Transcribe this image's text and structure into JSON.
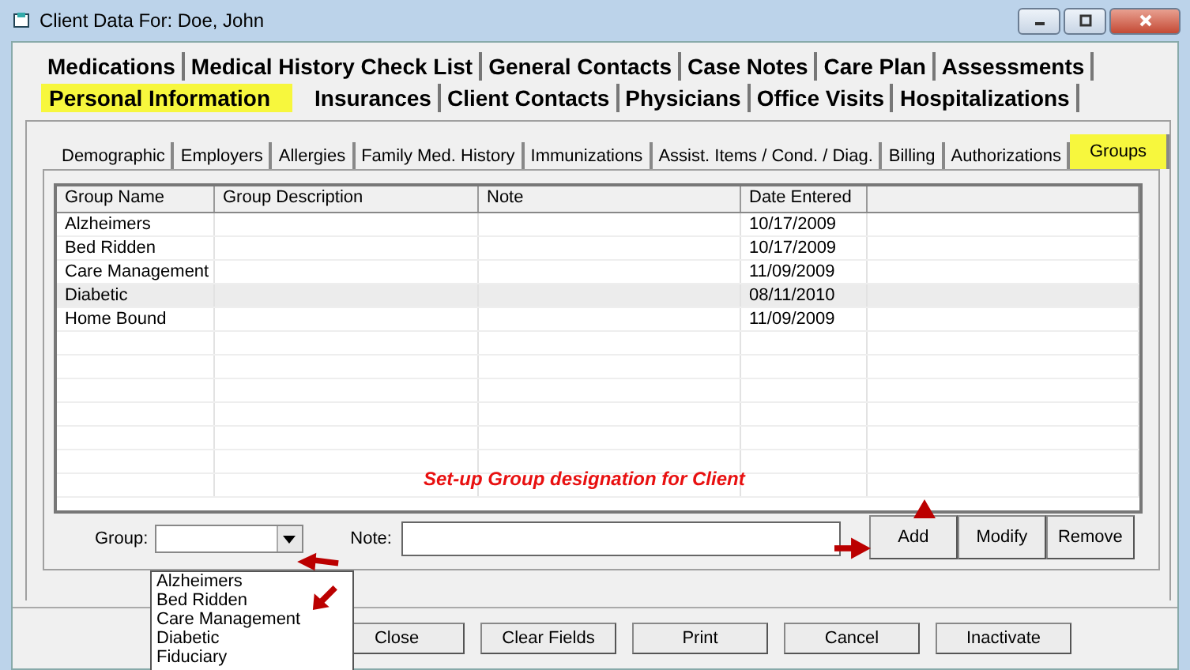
{
  "window": {
    "title": "Client Data For: Doe, John"
  },
  "main_tabs": [
    [
      {
        "label": "Medications",
        "selected": false
      },
      {
        "label": "Medical History Check List",
        "selected": false
      },
      {
        "label": "General Contacts",
        "selected": false
      },
      {
        "label": "Case Notes",
        "selected": false
      },
      {
        "label": "Care Plan",
        "selected": false
      },
      {
        "label": "Assessments",
        "selected": false
      }
    ],
    [
      {
        "label": "Personal Information",
        "selected": true
      },
      {
        "label": "Insurances",
        "selected": false
      },
      {
        "label": "Client Contacts",
        "selected": false
      },
      {
        "label": "Physicians",
        "selected": false
      },
      {
        "label": "Office Visits",
        "selected": false
      },
      {
        "label": "Hospitalizations",
        "selected": false
      }
    ]
  ],
  "sub_tabs": [
    {
      "label": "Demographic",
      "selected": false
    },
    {
      "label": "Employers",
      "selected": false
    },
    {
      "label": "Allergies",
      "selected": false
    },
    {
      "label": "Family Med. History",
      "selected": false
    },
    {
      "label": "Immunizations",
      "selected": false
    },
    {
      "label": "Assist. Items / Cond. / Diag.",
      "selected": false
    },
    {
      "label": "Billing",
      "selected": false
    },
    {
      "label": "Authorizations",
      "selected": false
    },
    {
      "label": "Groups",
      "selected": true
    }
  ],
  "table": {
    "columns": [
      "Group Name",
      "Group Description",
      "Note",
      "Date Entered"
    ],
    "rows": [
      {
        "cells": [
          "Alzheimers",
          "",
          "",
          "10/17/2009"
        ],
        "selected": false
      },
      {
        "cells": [
          "Bed Ridden",
          "",
          "",
          "10/17/2009"
        ],
        "selected": false
      },
      {
        "cells": [
          "Care Management",
          "",
          "",
          "11/09/2009"
        ],
        "selected": false
      },
      {
        "cells": [
          "Diabetic",
          "",
          "",
          "08/11/2010"
        ],
        "selected": true
      },
      {
        "cells": [
          "Home Bound",
          "",
          "",
          "11/09/2009"
        ],
        "selected": false
      }
    ]
  },
  "annotation": "Set-up Group designation for Client",
  "group_field": {
    "label": "Group:",
    "options": [
      "Alzheimers",
      "Bed Ridden",
      "Care Management",
      "Diabetic",
      "Fiduciary"
    ]
  },
  "note_field": {
    "label": "Note:"
  },
  "row_buttons": [
    "Add",
    "Modify",
    "Remove"
  ],
  "bottom_buttons": [
    "Close",
    "Clear Fields",
    "Print",
    "Cancel",
    "Inactivate"
  ]
}
